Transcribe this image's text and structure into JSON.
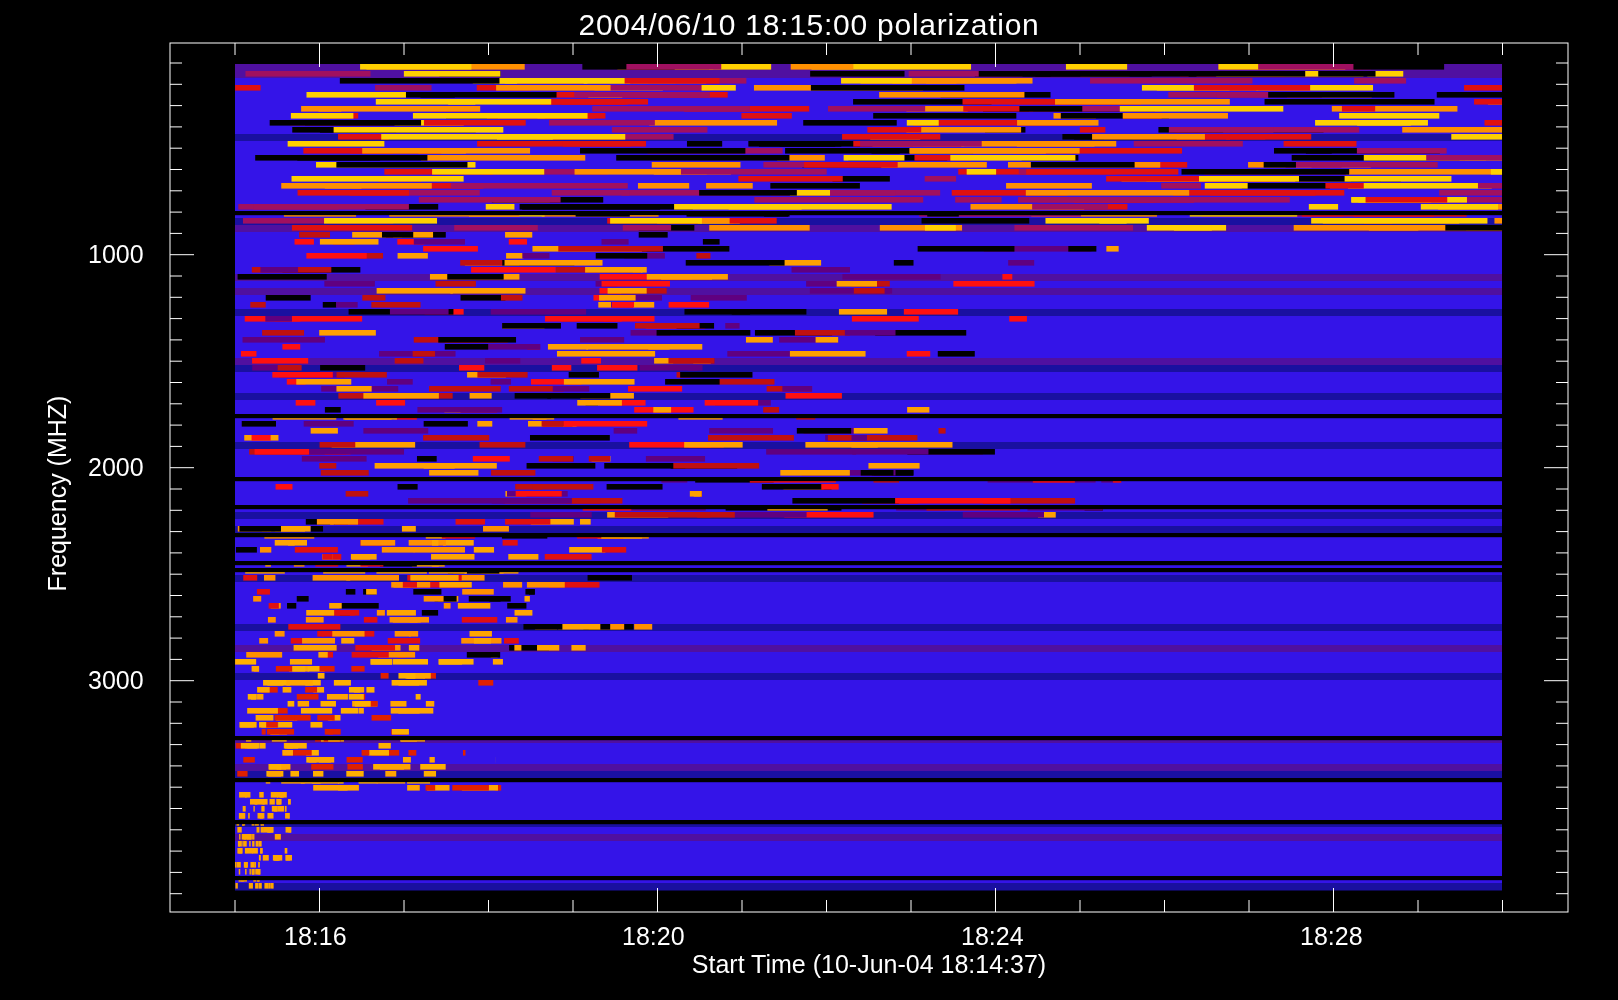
{
  "title": "2004/06/10 18:15:00 polarization",
  "y_axis": {
    "label": "Frequency (MHZ)",
    "ticks": [
      "1000",
      "2000",
      "3000"
    ]
  },
  "x_axis": {
    "label": "Start Time (10-Jun-04 18:14:37)",
    "ticks": [
      "18:16",
      "18:20",
      "18:24",
      "18:28"
    ]
  }
}
